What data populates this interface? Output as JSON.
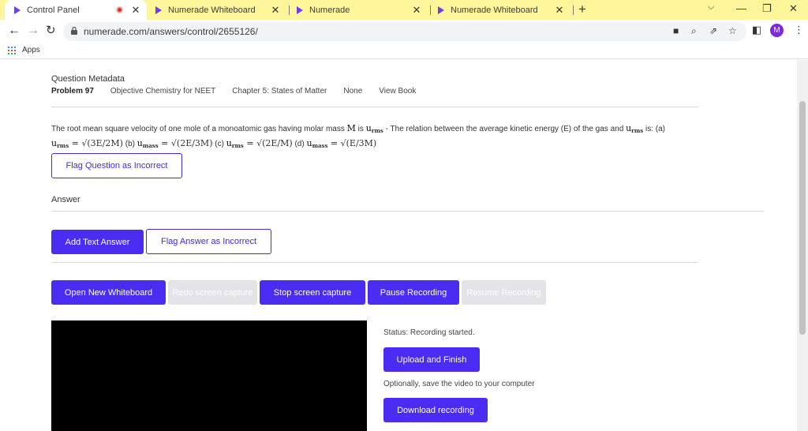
{
  "browser": {
    "tabs": [
      {
        "title": "Control Panel",
        "active": true,
        "recording": true
      },
      {
        "title": "Numerade Whiteboard",
        "active": false
      },
      {
        "title": "Numerade",
        "active": false
      },
      {
        "title": "Numerade Whiteboard",
        "active": false
      }
    ],
    "url": "numerade.com/answers/control/2655126/",
    "profile_initial": "M",
    "bookmarks": {
      "apps_label": "Apps"
    },
    "colors": {
      "tabstrip": "#fff59a",
      "accent": "#4b2cf2",
      "avatar": "#7b2bd6"
    }
  },
  "metadata": {
    "heading": "Question Metadata",
    "problem": "Problem 97",
    "book": "Objective Chemistry for NEET",
    "chapter": "Chapter 5: States of Matter",
    "section": "None",
    "view_book": "View Book"
  },
  "question": {
    "text_1": "The root mean square velocity of one mole of a monoatomic gas having molar mass ",
    "M": "M",
    "text_is": " is ",
    "u": "u",
    "rms": "rms",
    "text_2": " - The relation between the average kinetic energy (E) of the gas and ",
    "text_3": " is: (a)",
    "opt_a_eq": "(3E/2M)",
    "opt_b_label": " (b) ",
    "mass_sub": "mass",
    "opt_b_eq": "(2E/3M)",
    "opt_c_label": " (c) ",
    "opt_c_eq": "(2E/M)",
    "opt_d_label": " (d) ",
    "opt_d_eq": "(E/3M)"
  },
  "buttons": {
    "flag_question": "Flag Question as Incorrect",
    "add_text_answer": "Add Text Answer",
    "flag_answer": "Flag Answer as Incorrect",
    "open_whiteboard": "Open New Whiteboard",
    "redo_capture": "Redo screen capture",
    "stop_capture": "Stop screen capture",
    "pause_recording": "Pause Recording",
    "resume_recording": "Resume Recording",
    "upload_finish": "Upload and Finish",
    "download_recording": "Download recording"
  },
  "answer_label": "Answer",
  "status_text": "Status: Recording started.",
  "optional_text": "Optionally, save the video to your computer"
}
